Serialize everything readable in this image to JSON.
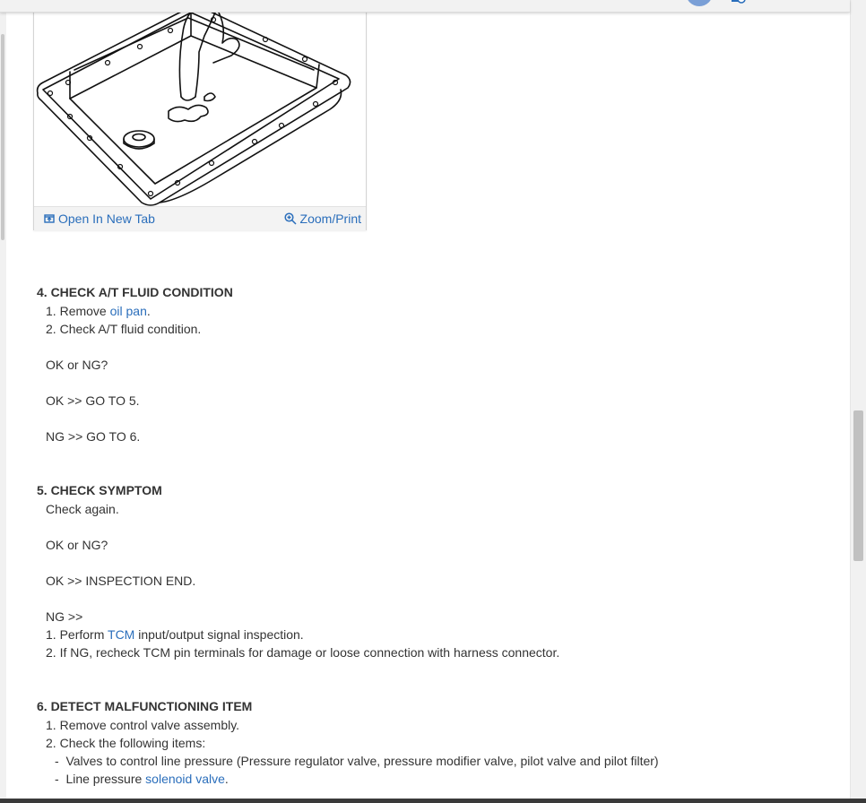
{
  "figure": {
    "open_label": "Open In New Tab",
    "zoom_label": "Zoom/Print"
  },
  "steps": [
    {
      "title": "4. CHECK A/T FLUID CONDITION",
      "items": [
        {
          "num": "1.",
          "pre": "Remove ",
          "link": "oil pan",
          "post": "."
        },
        {
          "num": "2.",
          "text": "Check A/T fluid condition."
        }
      ],
      "question": "OK or NG?",
      "ok": "OK >> GO TO 5.",
      "ng": "NG >> GO TO 6."
    },
    {
      "title": "5. CHECK SYMPTOM",
      "intro": "Check again.",
      "question": "OK or NG?",
      "ok": "OK >> INSPECTION END.",
      "ng": "NG >>",
      "items": [
        {
          "num": "1.",
          "pre": "Perform ",
          "link": "TCM",
          "post": " input/output signal inspection."
        },
        {
          "num": "2.",
          "text": "If NG, recheck TCM pin terminals for damage or loose connection with harness connector."
        }
      ]
    },
    {
      "title": "6. DETECT MALFUNCTIONING ITEM",
      "items": [
        {
          "num": "1.",
          "text": "Remove control valve assembly."
        },
        {
          "num": "2.",
          "text": "Check the following items:"
        }
      ],
      "subitems": [
        {
          "dash": "-",
          "text": "Valves to control line pressure (Pressure regulator valve, pressure modifier valve, pilot valve and pilot filter)"
        },
        {
          "dash": "-",
          "pre": "Line pressure ",
          "link": "solenoid valve",
          "post": "."
        }
      ]
    }
  ],
  "icons": {
    "open_icon": "open-in-new-tab-icon",
    "zoom_icon": "zoom-in-icon",
    "notif_icon": "notification-icon"
  },
  "colors": {
    "link": "#2a6ebb",
    "text": "#333333",
    "avatar": "#7a9fd6"
  }
}
